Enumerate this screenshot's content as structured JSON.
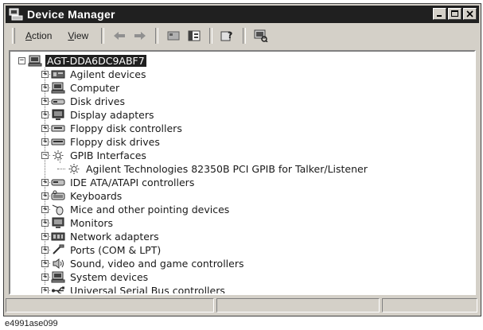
{
  "window": {
    "title": "Device Manager",
    "title_icon": "device-manager-icon",
    "buttons": [
      "minimize-icon",
      "maximize-icon",
      "close-icon"
    ]
  },
  "toolbar": {
    "menus": [
      "Action",
      "View"
    ],
    "icons": [
      "back-arrow-icon",
      "forward-arrow-icon",
      "properties-icon",
      "tree-view-icon",
      "help-icon",
      "scan-hardware-icon"
    ]
  },
  "tree": {
    "root": {
      "label": "AGT-DDA6DC9ABF7",
      "icon": "computer-icon",
      "expanded": true
    },
    "items": [
      {
        "label": "Agilent devices",
        "icon": "agilent-device-icon",
        "expander": "+"
      },
      {
        "label": "Computer",
        "icon": "computer-icon",
        "expander": "+"
      },
      {
        "label": "Disk drives",
        "icon": "disk-drive-icon",
        "expander": "+"
      },
      {
        "label": "Display adapters",
        "icon": "display-adapter-icon",
        "expander": "+"
      },
      {
        "label": "Floppy disk controllers",
        "icon": "floppy-controller-icon",
        "expander": "+"
      },
      {
        "label": "Floppy disk drives",
        "icon": "floppy-drive-icon",
        "expander": "+"
      },
      {
        "label": "GPIB Interfaces",
        "icon": "gpib-icon",
        "expander": "-"
      },
      {
        "label": "Agilent Technologies 82350B PCI GPIB for Talker/Listener",
        "icon": "gpib-icon",
        "child": true
      },
      {
        "label": "IDE ATA/ATAPI controllers",
        "icon": "ide-controller-icon",
        "expander": "+"
      },
      {
        "label": "Keyboards",
        "icon": "keyboard-icon",
        "expander": "+"
      },
      {
        "label": "Mice and other pointing devices",
        "icon": "mouse-icon",
        "expander": "+"
      },
      {
        "label": "Monitors",
        "icon": "monitor-icon",
        "expander": "+"
      },
      {
        "label": "Network adapters",
        "icon": "network-adapter-icon",
        "expander": "+"
      },
      {
        "label": "Ports (COM & LPT)",
        "icon": "port-icon",
        "expander": "+"
      },
      {
        "label": "Sound, video and game controllers",
        "icon": "sound-icon",
        "expander": "+"
      },
      {
        "label": "System devices",
        "icon": "system-device-icon",
        "expander": "+"
      },
      {
        "label": "Universal Serial Bus controllers",
        "icon": "usb-icon",
        "expander": "+"
      }
    ]
  },
  "caption": "e4991ase099"
}
